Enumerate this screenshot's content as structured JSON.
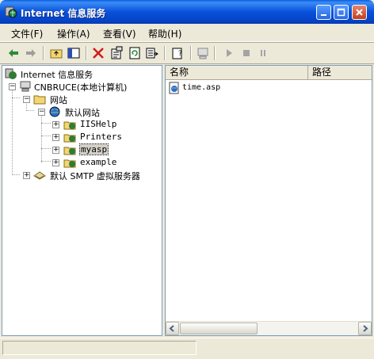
{
  "window": {
    "title": "Internet 信息服务"
  },
  "menu": [
    {
      "label": "文件(F)"
    },
    {
      "label": "操作(A)"
    },
    {
      "label": "查看(V)"
    },
    {
      "label": "帮助(H)"
    }
  ],
  "tree": {
    "root": "Internet 信息服务",
    "computer": "CNBRUCE(本地计算机)",
    "sites": "网站",
    "default_site": "默认网站",
    "children": [
      "IISHelp",
      "Printers",
      "myasp",
      "example"
    ],
    "smtp": "默认 SMTP 虚拟服务器"
  },
  "list": {
    "columns": [
      "名称",
      "路径"
    ],
    "items": [
      {
        "name": "time.asp"
      }
    ]
  }
}
